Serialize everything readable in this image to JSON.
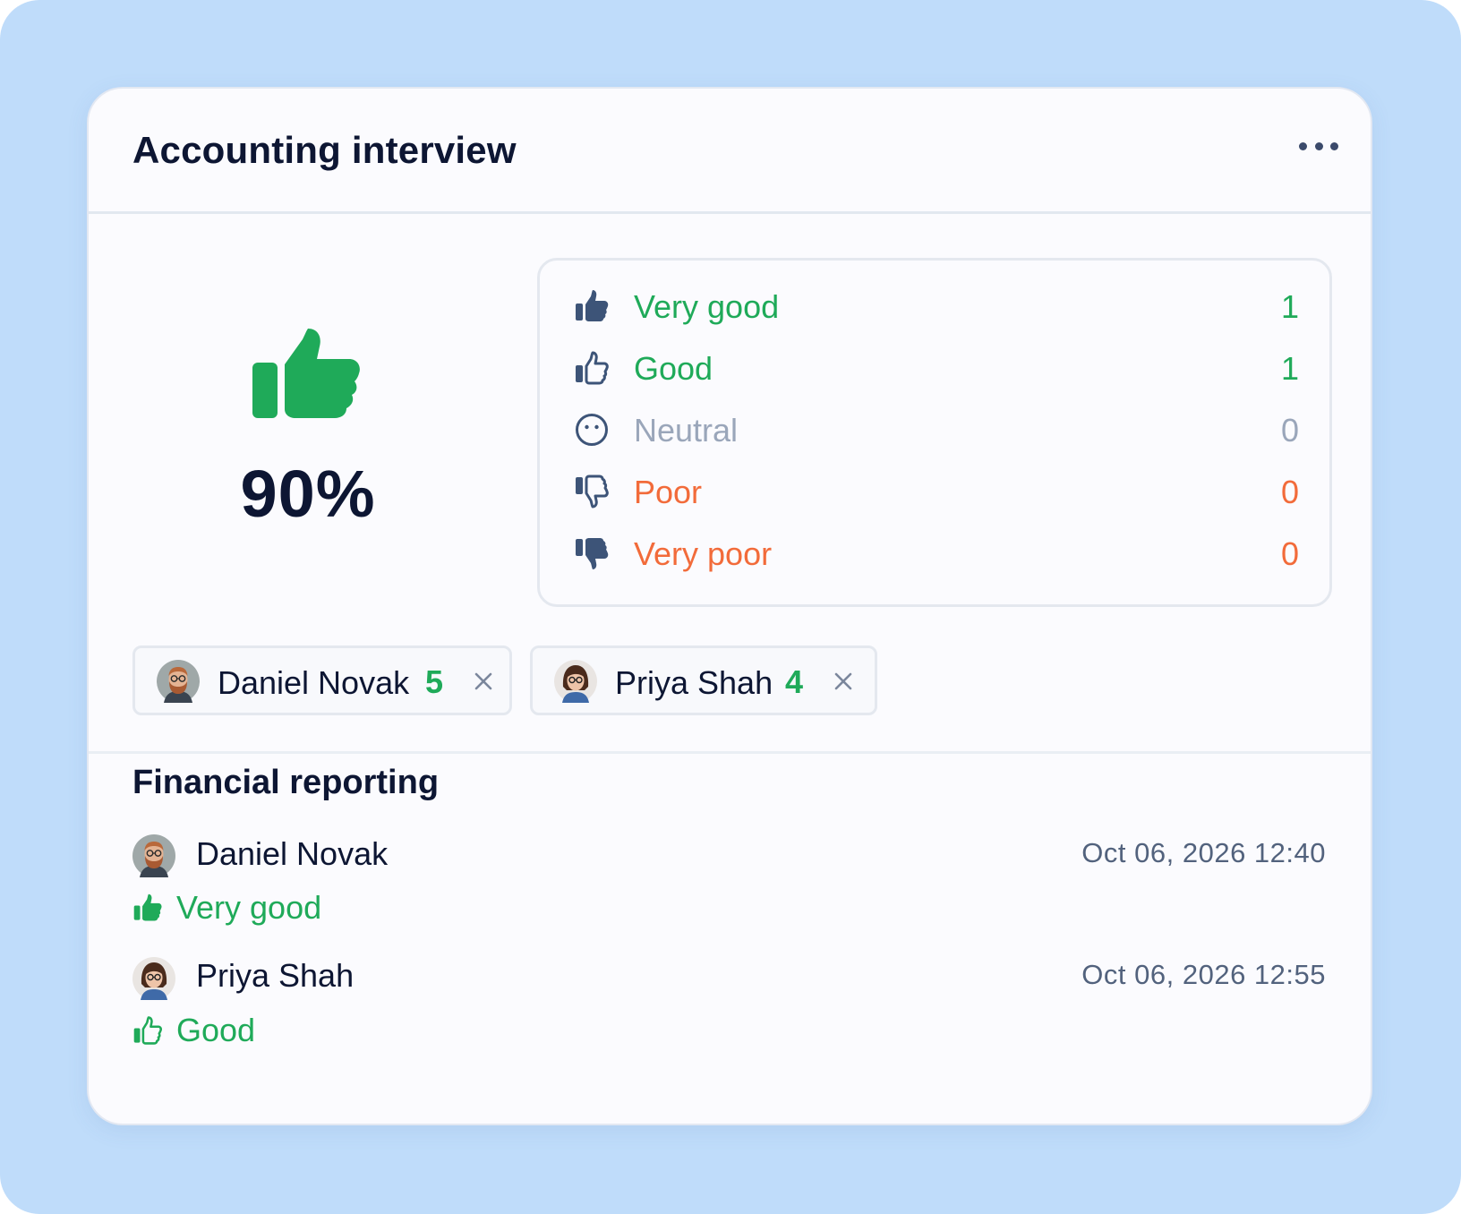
{
  "card": {
    "title": "Accounting interview",
    "more_icon": "more-horizontal-icon"
  },
  "summary": {
    "score": "90%",
    "icon": "thumbs-up-filled-icon",
    "icon_color": "#1faa59",
    "distribution": [
      {
        "label": "Very good",
        "count": "1",
        "icon": "thumbs-up-filled-icon",
        "color": "#1faa59"
      },
      {
        "label": "Good",
        "count": "1",
        "icon": "thumbs-up-outline-icon",
        "color": "#1faa59"
      },
      {
        "label": "Neutral",
        "count": "0",
        "icon": "neutral-face-icon",
        "color": "#9aa6ba"
      },
      {
        "label": "Poor",
        "count": "0",
        "icon": "thumbs-down-outline-icon",
        "color": "#f26b3a"
      },
      {
        "label": "Very poor",
        "count": "0",
        "icon": "thumbs-down-filled-icon",
        "color": "#f26b3a"
      }
    ]
  },
  "interviewers": [
    {
      "name": "Daniel Novak",
      "score": "5"
    },
    {
      "name": "Priya Shah",
      "score": "4"
    }
  ],
  "section": {
    "title": "Financial reporting",
    "entries": [
      {
        "name": "Daniel Novak",
        "date": "Oct 06, 2026 12:40",
        "rating": "Very good",
        "icon": "thumbs-up-filled-icon"
      },
      {
        "name": "Priya Shah",
        "date": "Oct 06, 2026 12:55",
        "rating": "Good",
        "icon": "thumbs-up-outline-icon"
      }
    ]
  },
  "colors": {
    "background": "#bfdcfa",
    "positive": "#1faa59",
    "negative": "#f26b3a",
    "neutral": "#9aa6ba",
    "icon": "#3d5478"
  }
}
